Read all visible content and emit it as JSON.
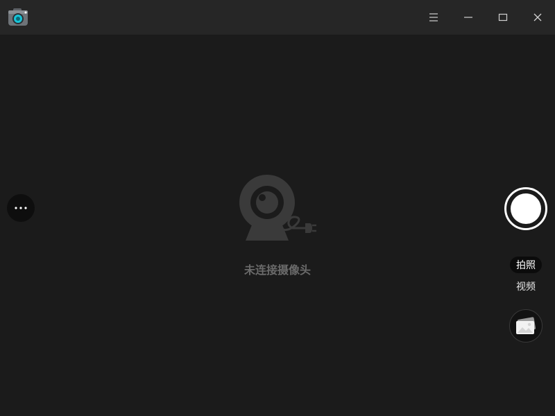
{
  "titlebar": {
    "app_icon": "camera-app-icon",
    "buttons": {
      "menu": "menu-icon",
      "minimize": "minimize-icon",
      "maximize": "maximize-icon",
      "close": "close-icon"
    }
  },
  "main": {
    "status_text": "未连接摄像头",
    "illustration_icon": "webcam-disconnected-icon"
  },
  "left_panel": {
    "more_icon": "more-dots-icon"
  },
  "right_panel": {
    "shutter_icon": "shutter-icon",
    "modes": [
      {
        "label": "拍照",
        "selected": true
      },
      {
        "label": "视频",
        "selected": false
      }
    ],
    "gallery_icon": "gallery-icon"
  },
  "colors": {
    "background": "#1b1b1b",
    "titlebar": "#262626",
    "accent": "#17c5d8",
    "muted_text": "#6a6a6a"
  }
}
